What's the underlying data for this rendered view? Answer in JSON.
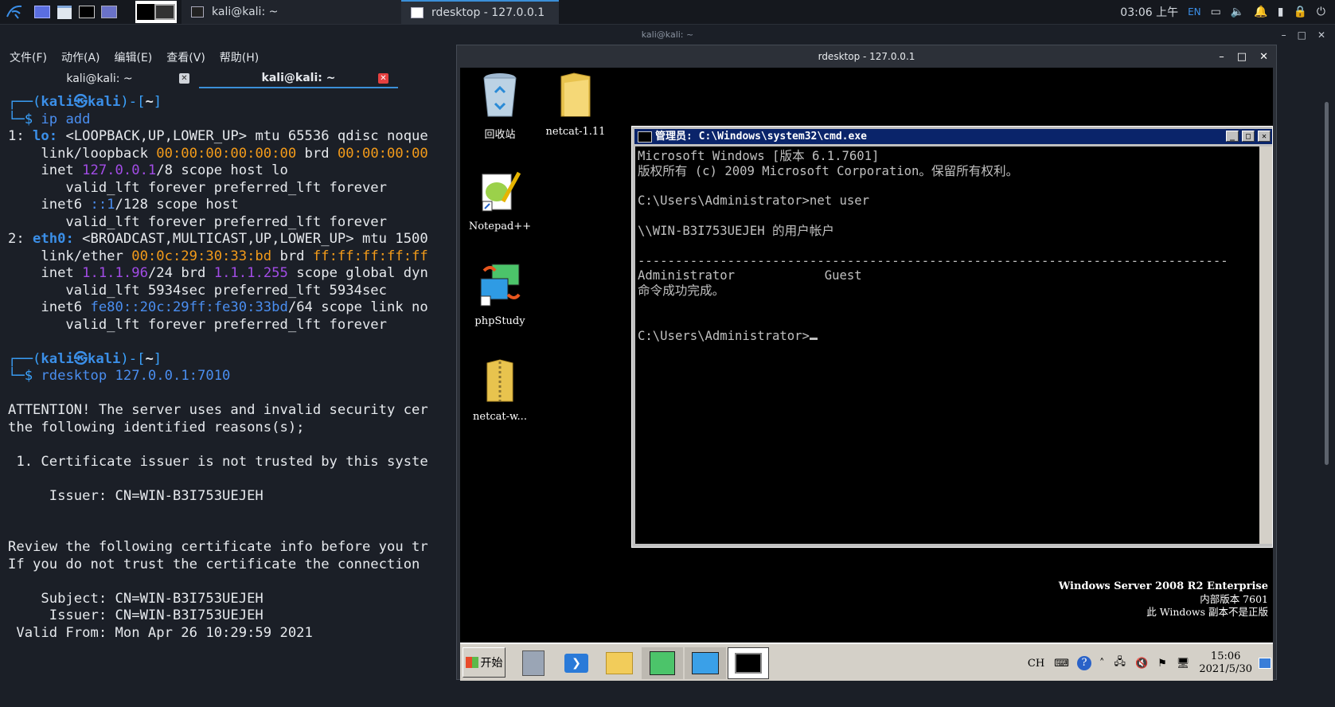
{
  "topbar": {
    "tasks": [
      {
        "label": "kali@kali: ~"
      },
      {
        "label": "rdesktop - 127.0.0.1"
      }
    ],
    "clock": "03:06 上午",
    "lang": "EN"
  },
  "terminal": {
    "window_title": "kali@kali: ~",
    "menu": [
      "文件(F)",
      "动作(A)",
      "编辑(E)",
      "查看(V)",
      "帮助(H)"
    ],
    "tabs": [
      {
        "label": "kali@kali: ~"
      },
      {
        "label": "kali@kali: ~"
      }
    ],
    "prompt1_cmd": "ip add",
    "prompt2_cmd": "rdesktop 127.0.0.1:7010",
    "lines": {
      "l1": "1: lo: <LOOPBACK,UP,LOWER_UP> mtu 65536 qdisc noque",
      "l2a": "    link/loopback ",
      "l2b": "00:00:00:00:00:00",
      "l2c": " brd ",
      "l2d": "00:00:00:00",
      "l3a": "    inet ",
      "l3b": "127.0.0.1",
      "l3c": "/8 scope host lo",
      "l4": "       valid_lft forever preferred_lft forever",
      "l5a": "    inet6 ",
      "l5b": "::1",
      "l5c": "/128 scope host",
      "l6": "       valid_lft forever preferred_lft forever",
      "l7a": "2: ",
      "l7b": "eth0:",
      "l7c": " <BROADCAST,MULTICAST,UP,LOWER_UP> mtu 1500",
      "l8a": "    link/ether ",
      "l8b": "00:0c:29:30:33:bd",
      "l8c": " brd ",
      "l8d": "ff:ff:ff:ff:ff",
      "l9a": "    inet ",
      "l9b": "1.1.1.96",
      "l9c": "/24 brd ",
      "l9d": "1.1.1.255",
      "l9e": " scope global dyn",
      "l10": "       valid_lft 5934sec preferred_lft 5934sec",
      "l11a": "    inet6 ",
      "l11b": "fe80::20c:29ff:fe30:33bd",
      "l11c": "/64 scope link no",
      "l12": "       valid_lft forever preferred_lft forever",
      "a1": "ATTENTION! The server uses and invalid security cer",
      "a2": "the following identified reasons(s);",
      "a3": " 1. Certificate issuer is not trusted by this syste",
      "a4": "     Issuer: CN=WIN-B3I753UEJEH",
      "a5": "Review the following certificate info before you tr",
      "a6": "If you do not trust the certificate the connection",
      "a7": "    Subject: CN=WIN-B3I753UEJEH",
      "a8": "     Issuer: CN=WIN-B3I753UEJEH",
      "a9": " Valid From: Mon Apr 26 10:29:59 2021"
    }
  },
  "rdesktop": {
    "title": "rdesktop - 127.0.0.1",
    "icons": [
      "回收站",
      "netcat-1.11",
      "Notepad++",
      "phpStudy",
      "netcat-w..."
    ],
    "cmd": {
      "title": "管理员: C:\\Windows\\system32\\cmd.exe",
      "lines": [
        "Microsoft Windows [版本 6.1.7601]",
        "版权所有 (c) 2009 Microsoft Corporation。保留所有权利。",
        "",
        "C:\\Users\\Administrator>net user",
        "",
        "\\\\WIN-B3I753UEJEH 的用户帐户",
        "",
        "-------------------------------------------------------------------------------",
        "Administrator            Guest",
        "命令成功完成。",
        "",
        ""
      ],
      "prompt": "C:\\Users\\Administrator>"
    },
    "watermark": [
      "Windows Server 2008 R2 Enterprise",
      "内部版本 7601",
      "此 Windows 副本不是正版"
    ],
    "taskbar": {
      "start": "开始",
      "lang": "CH",
      "time": "15:06",
      "date": "2021/5/30"
    }
  }
}
